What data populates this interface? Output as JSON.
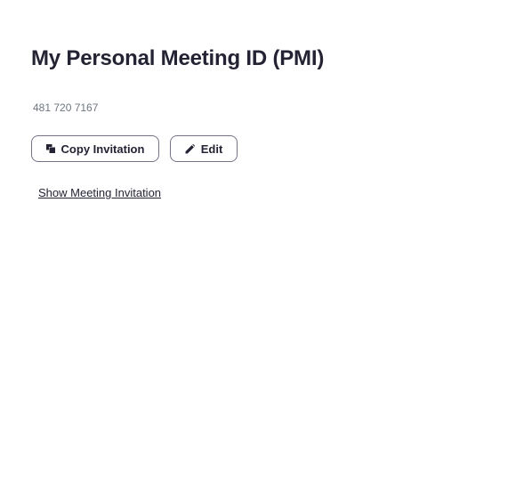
{
  "page": {
    "title": "My Personal Meeting ID (PMI)",
    "pmi_number": "481 720 7167"
  },
  "actions": {
    "copy_invitation_label": "Copy Invitation",
    "copy_icon": "copy-icon",
    "edit_label": "Edit",
    "edit_icon": "pencil-icon",
    "show_invitation_label": "Show Meeting Invitation"
  }
}
